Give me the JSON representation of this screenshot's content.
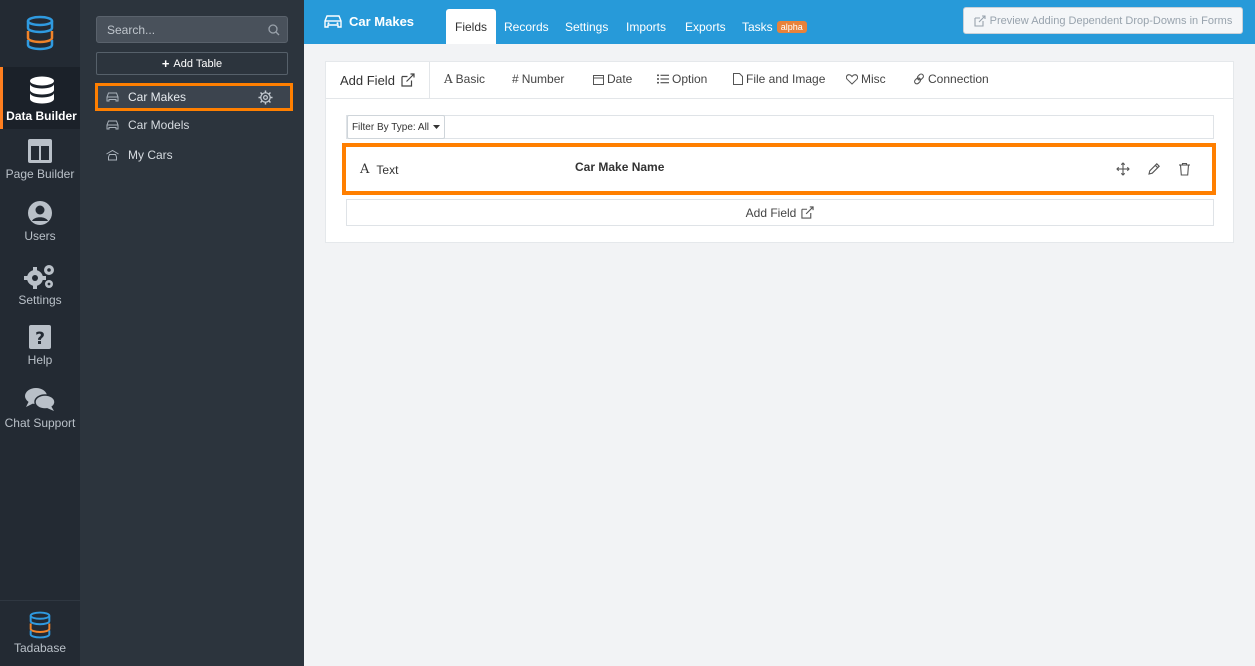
{
  "rail": {
    "items": [
      {
        "label": "Data Builder",
        "icon": "database-icon",
        "active": true
      },
      {
        "label": "Page Builder",
        "icon": "layout-icon"
      },
      {
        "label": "Users",
        "icon": "user-icon"
      },
      {
        "label": "Settings",
        "icon": "gears-icon"
      },
      {
        "label": "Help",
        "icon": "question-icon"
      },
      {
        "label": "Chat Support",
        "icon": "chat-icon"
      }
    ],
    "brand": "Tadabase"
  },
  "tables": {
    "search_placeholder": "Search...",
    "add_table_label": "Add Table",
    "items": [
      {
        "label": "Car Makes",
        "active": true
      },
      {
        "label": "Car Models"
      },
      {
        "label": "My Cars"
      }
    ]
  },
  "header": {
    "title": "Car Makes",
    "tabs": [
      {
        "label": "Fields",
        "active": true
      },
      {
        "label": "Records"
      },
      {
        "label": "Settings"
      },
      {
        "label": "Imports"
      },
      {
        "label": "Exports"
      },
      {
        "label": "Tasks",
        "badge": "alpha"
      }
    ],
    "preview_label": "Preview Adding Dependent Drop-Downs in Forms"
  },
  "fields": {
    "add_field_label": "Add Field",
    "types": [
      "Basic",
      "Number",
      "Date",
      "Option",
      "File and Image",
      "Misc",
      "Connection"
    ],
    "filter_label": "Filter By Type: All",
    "rows": [
      {
        "type": "Text",
        "name": "Car Make Name"
      }
    ],
    "add_field_bottom_label": "Add Field"
  },
  "colors": {
    "accent_orange": "#ff7f00",
    "header_blue": "#279ad9",
    "rail_dark": "#232a33",
    "sidebar_dark": "#2c343d"
  }
}
